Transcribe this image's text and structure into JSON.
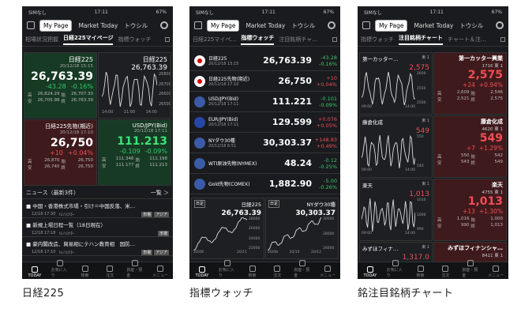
{
  "common": {
    "carrier": "SIMなし",
    "time": "17:11",
    "battery": "67%",
    "my_page": "My Page",
    "market_today": "Market Today",
    "toshiru": "トウシル",
    "nav": [
      "TODAY",
      "お気に入り",
      "検索",
      "注文",
      "資産・預金",
      "メニュー"
    ]
  },
  "captions": [
    "日経225",
    "指標ウォッチ",
    "銘注目銘柄チャート"
  ],
  "p1": {
    "tabs": [
      "相場状況把握",
      "日経225マイページ",
      "指標ウォッチ"
    ],
    "c1": {
      "name": "日経225",
      "date": "20/12/18 15:15",
      "price": "26,763.39",
      "chg": "-43.28",
      "pct": "-0.16%",
      "k": [
        "高",
        "安",
        "始",
        "終"
      ],
      "v": [
        "26,824.29",
        "26,705.98",
        "26,707.30",
        "26,763.39"
      ]
    },
    "c2": {
      "name": "日経225",
      "price": "26,763.39",
      "axis": [
        "26800",
        "26700",
        "26600",
        "26500"
      ],
      "x": [
        "14:00",
        "11:00",
        "14:00"
      ]
    },
    "c3": {
      "name": "日経225先物(期近)",
      "date": "20/12/18 17:10",
      "price": "26,750",
      "chg": "+10",
      "pct": "+0.04%",
      "k": [
        "高",
        "安",
        "始",
        "終"
      ],
      "v": [
        "26,870",
        "26,740",
        "26,750",
        "26,750"
      ]
    },
    "c4": {
      "name": "USD/JPY(Bid)",
      "date": "20/12/18 17:11",
      "price": "111.213",
      "chg": "-0.109",
      "pct": "-0.09%",
      "k": [
        "高",
        "安",
        "始",
        "終"
      ],
      "v": [
        "111.346",
        "111.177",
        "111.198",
        "111.213"
      ]
    },
    "news_title": "ニュース（最新3件）",
    "news_more": "一覧 ＞",
    "news": [
      {
        "t": "中国・香港株式市場・引け＝中国反落、米…",
        "d": "12/18 17:30",
        "s": "ﾄﾑｿﾝﾛｲﾀｰ",
        "tags": [
          "市場",
          "アジア"
        ]
      },
      {
        "t": "新規上場日程一覧（18日現在）",
        "d": "12/18 17:18",
        "s": "ﾄﾑｿﾝﾛｲﾀｰ",
        "tags": [
          "市場"
        ]
      },
      {
        "t": "豪内閣改造、貿易相にテハン教育相　国防…",
        "d": "12/18 17:10",
        "s": "ﾄﾑｿﾝﾛｲﾀｰ",
        "tags": [
          "市場",
          "アジア"
        ]
      }
    ]
  },
  "p2": {
    "tabs": [
      "日経225マイペ…",
      "指標ウォッチ",
      "注目銘柄チャ…"
    ],
    "rows": [
      {
        "name": "日経225",
        "date": "20/12/18 15:15",
        "price": "26,763.39",
        "chg": "-43.28",
        "pct": "-0.16%",
        "dir": "dn"
      },
      {
        "name": "日経225先物(期近)",
        "date": "20/12/18 17:10",
        "price": "26,750",
        "chg": "+10",
        "pct": "+0.04%",
        "dir": "up"
      },
      {
        "name": "USD/JPY(Bid)",
        "date": "20/12/18 17:11",
        "price": "111.221",
        "chg": "-0.101",
        "pct": "-0.09%",
        "dir": "dn"
      },
      {
        "name": "EUR/JPY(Bid)",
        "date": "20/12/18 17:11",
        "price": "129.599",
        "chg": "+0.076",
        "pct": "+0.05%",
        "dir": "up"
      },
      {
        "name": "NYダウ30種",
        "date": "20/12/18 6:51",
        "price": "30,303.37",
        "chg": "+148.83",
        "pct": "+0.49%",
        "dir": "up"
      },
      {
        "name": "WTI原油先物(NYMEX)",
        "date": "",
        "price": "48.24",
        "chg": "-0.12",
        "pct": "-0.25%",
        "dir": "dn"
      },
      {
        "name": "Gold先物(COMEX)",
        "date": "",
        "price": "1,882.90",
        "chg": "-5.00",
        "pct": "-0.26%",
        "dir": "dn"
      }
    ],
    "ch1": {
      "name": "日経225",
      "period": "日足",
      "price": "26,763.39",
      "axis": [
        "28000",
        "26000",
        "24000",
        "22000"
      ],
      "x": [
        "20/08",
        "20/11"
      ]
    },
    "ch2": {
      "name": "NYダウ30種",
      "period": "日足",
      "price": "30,303.37",
      "axis": [
        "30000",
        "28000",
        "26000"
      ],
      "x": [
        "20/08",
        "20/10",
        "20/12"
      ]
    }
  },
  "p3": {
    "tabs": [
      "指標ウォッチ",
      "注目銘柄チャート",
      "チャート＆注…"
    ],
    "stocks": [
      {
        "name": "第一カッター…",
        "exch": "東 1",
        "price": "2,575",
        "full": "第一カッター興業",
        "code": "1716",
        "exch2": "東 1",
        "price2": "2,575",
        "chg": "+24",
        "pct": "+0.94%",
        "k": [
          "高",
          "安",
          "始",
          "終"
        ],
        "v": [
          "2,609",
          "2,521",
          "2,546",
          "2,575"
        ],
        "axis": [
          "2600",
          "2550",
          "2500"
        ]
      },
      {
        "name": "藤倉化成",
        "exch": "東 1",
        "price": "549",
        "full": "藤倉化成",
        "code": "4620",
        "exch2": "東 1",
        "price2": "549",
        "chg": "+7",
        "pct": "+1.29%",
        "k": [
          "高",
          "安",
          "始",
          "終"
        ],
        "v": [
          "550",
          "543",
          "542",
          "549"
        ],
        "axis": [
          "550",
          "540"
        ]
      },
      {
        "name": "楽天",
        "exch": "東 1",
        "price": "1,013",
        "full": "楽天",
        "code": "4755",
        "exch2": "東 1",
        "price2": "1,013",
        "chg": "+13",
        "pct": "+1.30%",
        "k": [
          "高",
          "安",
          "始",
          "終"
        ],
        "v": [
          "1,016",
          "990",
          "1,000",
          "1,013"
        ],
        "axis": [
          "1010",
          "1000",
          "990"
        ]
      },
      {
        "name": "みずほフィナ…",
        "exch": "東 1",
        "price": "1,317.0",
        "full": "みずほフィナンシャ…",
        "code": "8411",
        "exch2": "東 1",
        "price2": "",
        "chg": "",
        "pct": "",
        "k": [],
        "v": [],
        "axis": []
      }
    ],
    "x": [
      "09:00",
      "14:00"
    ]
  }
}
